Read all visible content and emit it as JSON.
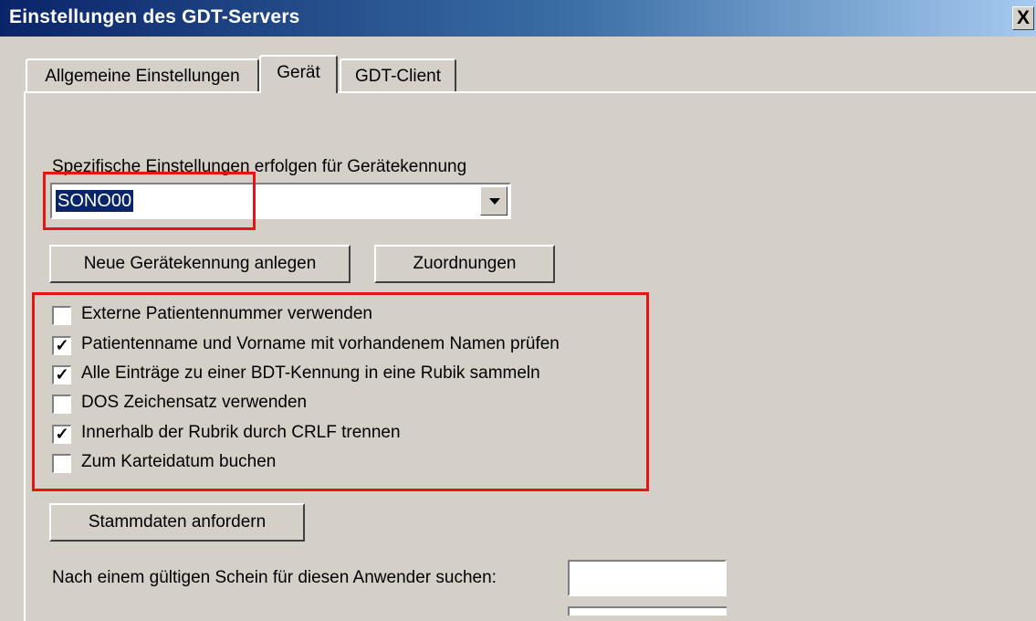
{
  "window": {
    "title": "Einstellungen des GDT-Servers",
    "close_label": "X"
  },
  "tabs": [
    {
      "label": "Allgemeine Einstellungen",
      "active": false
    },
    {
      "label": "Gerät",
      "active": true
    },
    {
      "label": "GDT-Client",
      "active": false
    }
  ],
  "device": {
    "label": "Spezifische Einstellungen erfolgen für Gerätekennung",
    "selected_value": "SONO00",
    "new_button": "Neue Gerätekennung anlegen",
    "assign_button": "Zuordnungen"
  },
  "options": [
    {
      "label": "Externe Patientennummer verwenden",
      "checked": false
    },
    {
      "label": "Patientenname und Vorname mit vorhandenem Namen prüfen",
      "checked": true
    },
    {
      "label": "Alle Einträge zu einer BDT-Kennung in eine Rubik sammeln",
      "checked": true
    },
    {
      "label": "DOS Zeichensatz verwenden",
      "checked": false
    },
    {
      "label": "Innerhalb der Rubrik durch CRLF trennen",
      "checked": true
    },
    {
      "label": "Zum Karteidatum buchen",
      "checked": false
    }
  ],
  "master_data_button": "Stammdaten anfordern",
  "search": {
    "label": "Nach einem gültigen Schein für diesen Anwender suchen:",
    "value": ""
  },
  "colors": {
    "highlight": "#e81414",
    "titlebar_start": "#0a246a",
    "dialog_bg": "#d4d0c8"
  }
}
